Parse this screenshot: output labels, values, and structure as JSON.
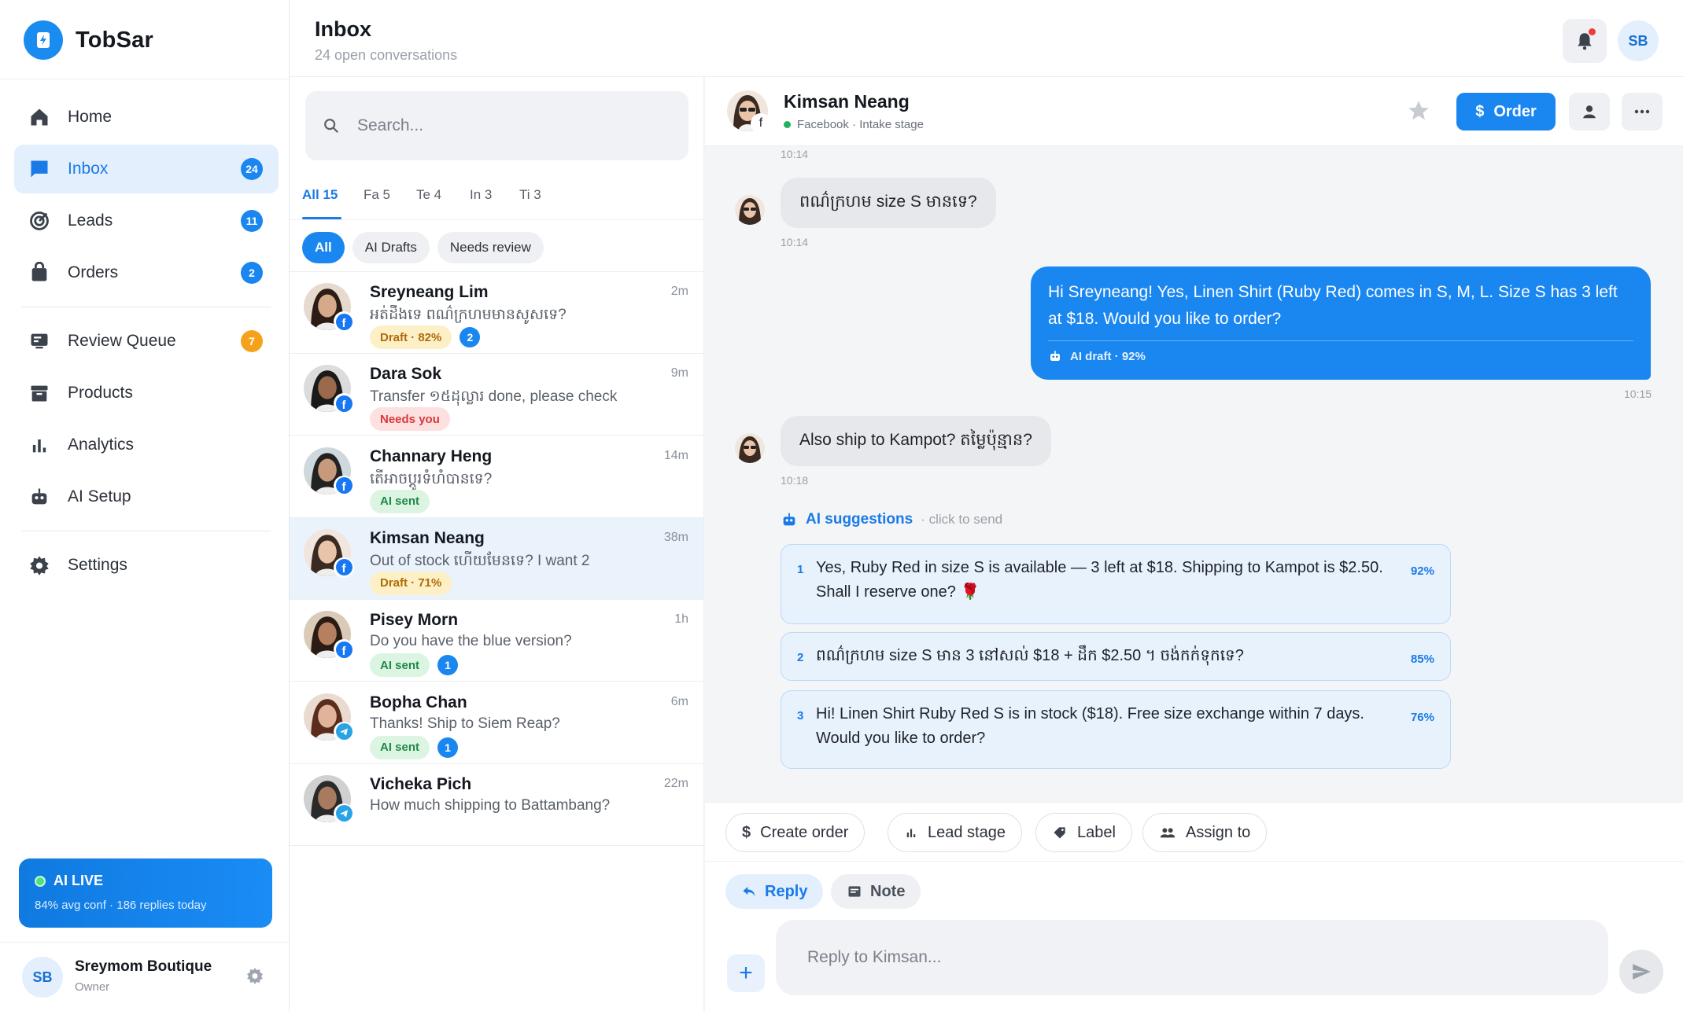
{
  "brand": {
    "name": "TobSar"
  },
  "sidebar": {
    "items": [
      {
        "label": "Home",
        "icon": "home-icon"
      },
      {
        "label": "Inbox",
        "icon": "chat-icon",
        "badge": "24",
        "active": true
      },
      {
        "label": "Leads",
        "icon": "target-icon",
        "badge": "11"
      },
      {
        "label": "Orders",
        "icon": "bag-icon",
        "badge": "2"
      },
      {
        "label": "Review Queue",
        "icon": "review-icon",
        "badge": "7"
      },
      {
        "label": "Products",
        "icon": "archive-icon"
      },
      {
        "label": "Analytics",
        "icon": "bar-chart-icon"
      },
      {
        "label": "AI Setup",
        "icon": "robot-icon"
      },
      {
        "label": "Settings",
        "icon": "gear-icon"
      }
    ],
    "ai_live": {
      "title": "AI LIVE",
      "subtitle": "84% avg conf · 186 replies today"
    },
    "account": {
      "initials": "SB",
      "name": "Sreymom Boutique",
      "role": "Owner"
    }
  },
  "header": {
    "title": "Inbox",
    "subtitle": "24 open conversations",
    "avatar_initials": "SB"
  },
  "search": {
    "placeholder": "Search..."
  },
  "tabs": [
    "All 15",
    "Fa 5",
    "Te 4",
    "In 3",
    "Ti 3"
  ],
  "filters": [
    "All",
    "AI Drafts",
    "Needs review"
  ],
  "conversations": [
    {
      "name": "Sreyneang Lim",
      "time": "2m",
      "message": "អត់ដឹងទេ ពណ៌ក្រហមមានសូសទេ?",
      "tag": "Draft · 82%",
      "tag_type": "draft",
      "count": "2",
      "source": "facebook"
    },
    {
      "name": "Dara Sok",
      "time": "9m",
      "message": "Transfer ១៥ដុល្លារ done, please check",
      "tag": "Needs you",
      "tag_type": "needs",
      "count": "",
      "source": "facebook"
    },
    {
      "name": "Channary Heng",
      "time": "14m",
      "message": "តើអាចប្តូរទំហំបានទេ?",
      "tag": "AI sent",
      "tag_type": "sent",
      "count": "",
      "source": "facebook"
    },
    {
      "name": "Kimsan Neang",
      "time": "38m",
      "message": "Out of stock ហើយមែនទេ? I want 2",
      "tag": "Draft · 71%",
      "tag_type": "draft",
      "count": "",
      "source": "facebook",
      "selected": true
    },
    {
      "name": "Pisey Morn",
      "time": "1h",
      "message": "Do you have the blue version?",
      "tag": "AI sent",
      "tag_type": "sent",
      "count": "1",
      "source": "facebook"
    },
    {
      "name": "Bopha Chan",
      "time": "6m",
      "message": "Thanks! Ship to Siem Reap?",
      "tag": "AI sent",
      "tag_type": "sent",
      "count": "1",
      "source": "telegram"
    },
    {
      "name": "Vicheka Pich",
      "time": "22m",
      "message": "How much shipping to Battambang?",
      "tag": "",
      "tag_type": "",
      "count": "",
      "source": "telegram"
    }
  ],
  "chat": {
    "name": "Kimsan Neang",
    "status": "Facebook · Intake stage",
    "order_label": "Order",
    "timestamps": {
      "top": "10:14",
      "m1": "10:14",
      "out": "10:15",
      "m2": "10:18"
    },
    "msg1": "ពណ៌ក្រហម size S មានទេ?",
    "outgoing": {
      "text": "Hi Sreyneang! Yes, Linen Shirt (Ruby Red) comes in S, M, L. Size S has 3 left at $18. Would you like to order?",
      "meta": "AI draft · 92%"
    },
    "msg2": "Also ship to Kampot? តម្លៃប៉ុន្មាន?",
    "suggestions_title": "AI suggestions",
    "suggestions_hint": "· click to send",
    "suggestions": [
      {
        "num": "1",
        "text": "Yes, Ruby Red in size S is available — 3 left at $18. Shipping to Kampot is $2.50. Shall I reserve one? 🌹",
        "pct": "92%"
      },
      {
        "num": "2",
        "text": "ពណ៌ក្រហម size S មាន 3 នៅសល់ $18 + ដឹក $2.50 ។ ចង់កក់ទុកទេ?",
        "pct": "85%"
      },
      {
        "num": "3",
        "text": "Hi! Linen Shirt Ruby Red S is in stock ($18). Free size exchange within 7 days. Would you like to order?",
        "pct": "76%"
      }
    ],
    "actions": [
      "Create order",
      "Lead stage",
      "Label",
      "Assign to"
    ],
    "reply_tab": "Reply",
    "note_tab": "Note",
    "reply_placeholder": "Reply to Kimsan..."
  },
  "colors": {
    "accent": "#1a86f0",
    "badge_orange": "#f5a21a",
    "draft": "#fdf0c7",
    "needs": "#fde0e0",
    "sent": "#dcf5e3"
  }
}
